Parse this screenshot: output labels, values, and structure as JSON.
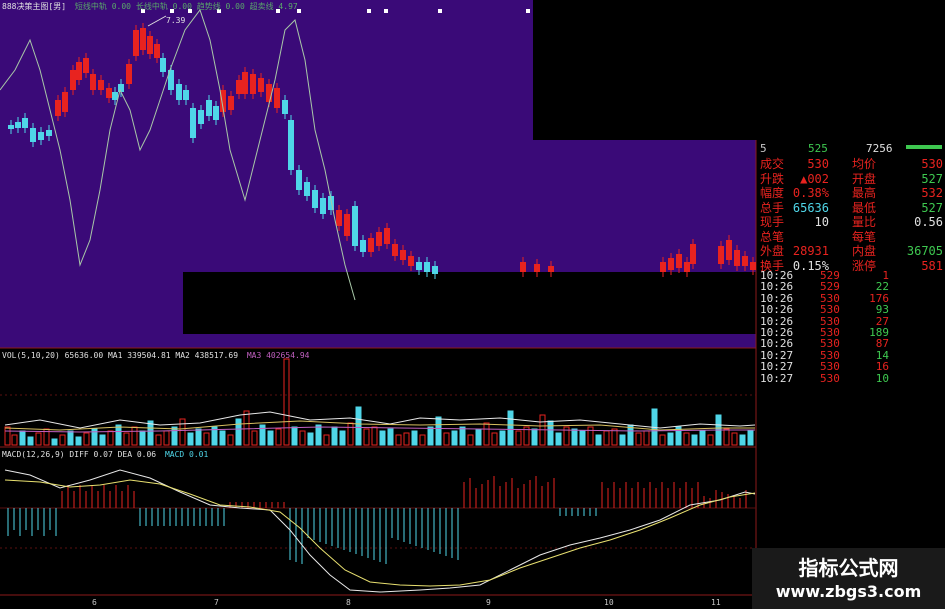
{
  "title_bar": {
    "indicator_title": "888决策主图[男]",
    "params": "短线中轨 0.00 长线中轨 0.00 趋势线 0.00 超卖线 4.97",
    "peak_label": "7.39"
  },
  "volume_panel": {
    "label": "VOL(5,10,20) 65636.00 MA1 339504.81 MA2 438517.69",
    "ma3": "MA3 402654.94"
  },
  "macd_panel": {
    "label": "MACD(12,26,9) DIFF 0.07 DEA 0.06",
    "macd_value": "MACD 0.01"
  },
  "x_axis": {
    "labels": [
      "6",
      "7",
      "8",
      "9",
      "10",
      "11"
    ]
  },
  "quote_header": {
    "num_a": "5",
    "num_b": "525",
    "num_c": "7256"
  },
  "quote": {
    "rows": [
      {
        "l1": "成交",
        "v1": "530",
        "l2": "均价",
        "v2": "530"
      },
      {
        "l1": "升跌",
        "v1": "▲002",
        "l2": "开盘",
        "v2": "527"
      },
      {
        "l1": "幅度",
        "v1": "0.38%",
        "l2": "最高",
        "v2": "532"
      },
      {
        "l1": "总手",
        "v1": "65636",
        "l2": "最低",
        "v2": "527"
      },
      {
        "l1": "现手",
        "v1": "10",
        "l2": "量比",
        "v2": "0.56"
      },
      {
        "l1": "总笔",
        "v1": "",
        "l2": "每笔",
        "v2": ""
      },
      {
        "l1": "外盘",
        "v1": "28931",
        "l2": "内盘",
        "v2": "36705"
      },
      {
        "l1": "换手",
        "v1": "0.15%",
        "l2": "涨停",
        "v2": "581"
      }
    ]
  },
  "ticks": [
    {
      "time": "10:26",
      "price": "529",
      "vol": "1"
    },
    {
      "time": "10:26",
      "price": "529",
      "vol": "22"
    },
    {
      "time": "10:26",
      "price": "530",
      "vol": "176"
    },
    {
      "time": "10:26",
      "price": "530",
      "vol": "93"
    },
    {
      "time": "10:26",
      "price": "530",
      "vol": "27"
    },
    {
      "time": "10:26",
      "price": "530",
      "vol": "189"
    },
    {
      "time": "10:26",
      "price": "530",
      "vol": "87"
    },
    {
      "time": "10:27",
      "price": "530",
      "vol": "14"
    },
    {
      "time": "10:27",
      "price": "530",
      "vol": "16"
    },
    {
      "time": "10:27",
      "price": "530",
      "vol": "10"
    }
  ],
  "watermark": {
    "title": "指标公式网",
    "url": "www.zbgs3.com"
  },
  "colors": {
    "main_bg": "#3a0a78",
    "up": "#e8231f",
    "down": "#4fd6e8",
    "line": "#a8c8a8",
    "grid": "#8b1a1a"
  }
}
